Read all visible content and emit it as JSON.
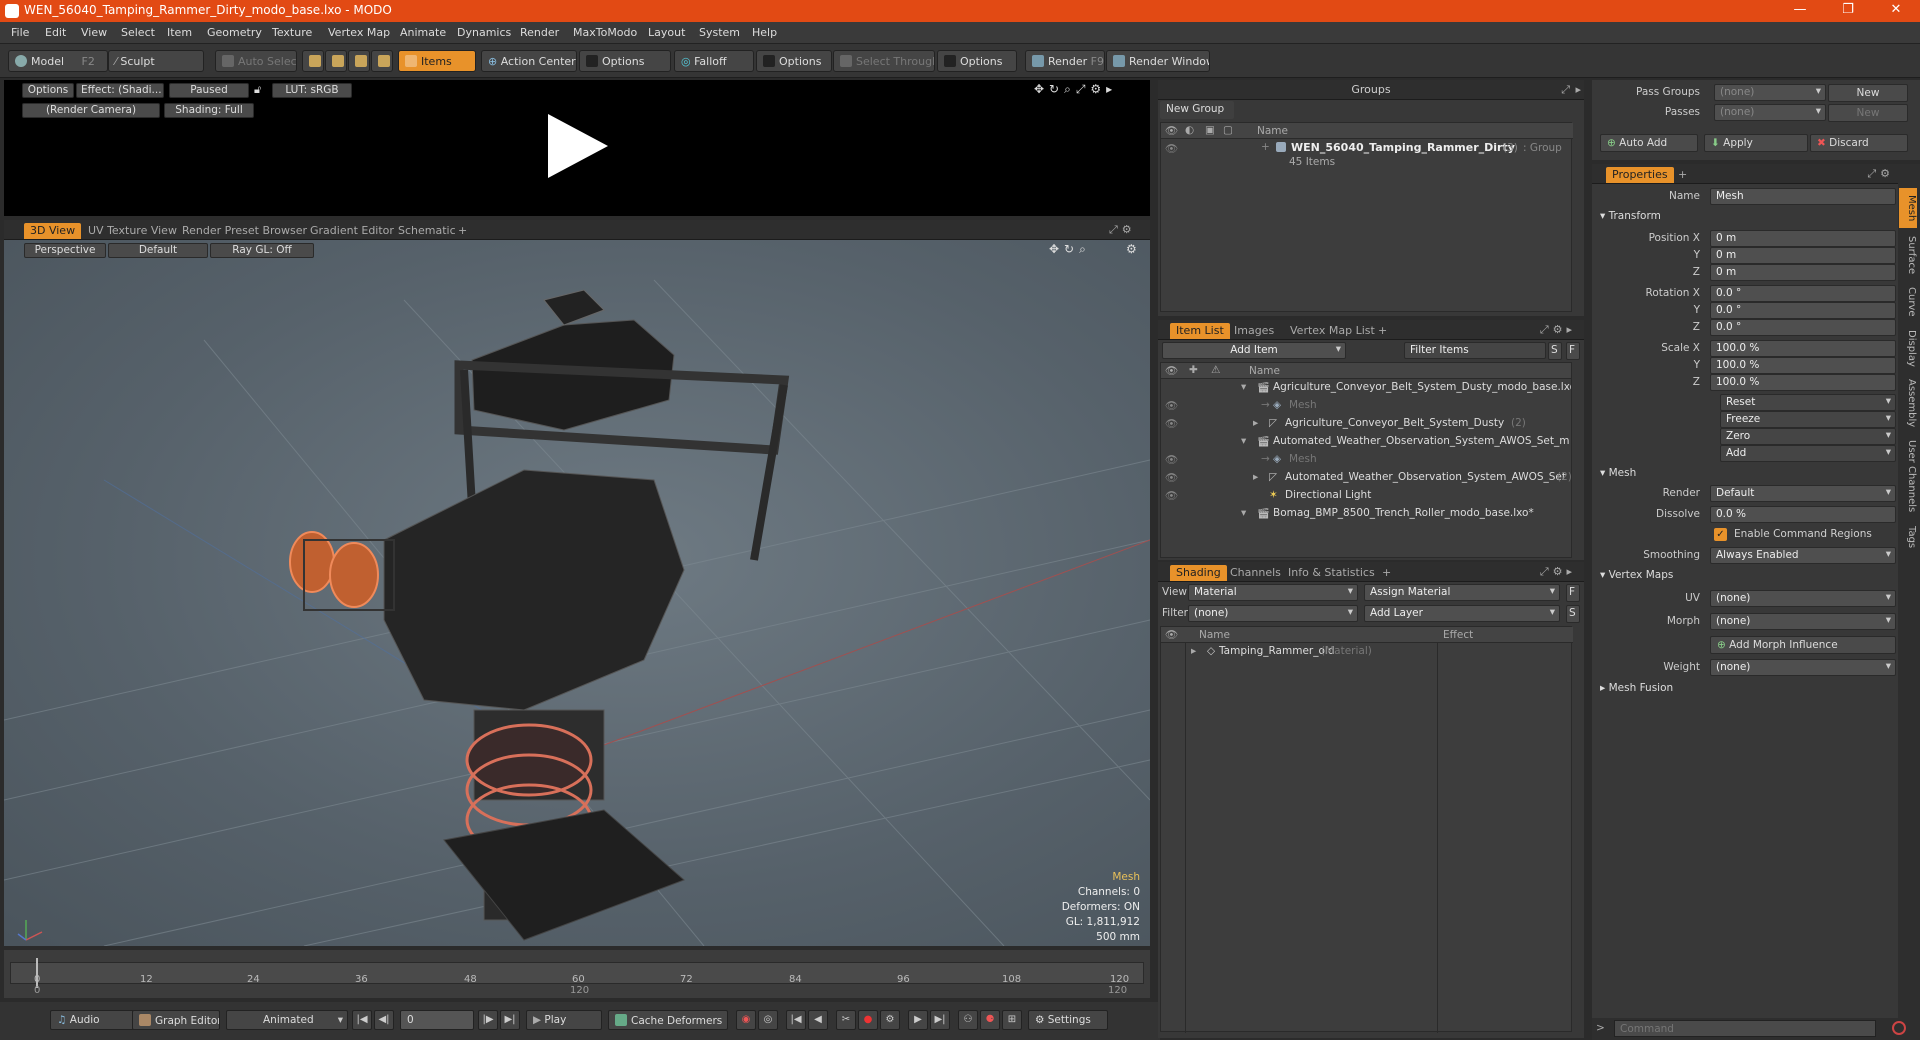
{
  "window": {
    "title": "WEN_56040_Tamping_Rammer_Dirty_modo_base.lxo - MODO",
    "minimize": "—",
    "maximize": "❐",
    "close": "✕"
  },
  "menu": [
    "File",
    "Edit",
    "View",
    "Select",
    "Item",
    "Geometry",
    "Texture",
    "Vertex Map",
    "Animate",
    "Dynamics",
    "Render",
    "MaxToModo",
    "Layout",
    "System",
    "Help"
  ],
  "toolbar": {
    "model": "Model",
    "model_key": "F2",
    "sculpt": "Sculpt",
    "auto_select": "Auto Select",
    "items": "Items",
    "action_center": "Action Center",
    "options1": "Options",
    "falloff": "Falloff",
    "options2": "Options",
    "select_through": "Select Through",
    "options3": "Options",
    "render": "Render",
    "render_key": "F9",
    "render_window": "Render Window"
  },
  "preview": {
    "options": "Options",
    "effect": "Effect: (Shadi...",
    "paused": "Paused",
    "lut": "LUT: sRGB",
    "camera": "(Render Camera)",
    "shading": "Shading: Full"
  },
  "viewport_tabs": [
    "3D View",
    "UV Texture View",
    "Render Preset Browser",
    "Gradient Editor",
    "Schematic",
    "+"
  ],
  "viewport": {
    "perspective": "Perspective",
    "default": "Default",
    "raygl": "Ray GL: Off",
    "info_title": "Mesh",
    "channels": "Channels: 0",
    "deformers": "Deformers: ON",
    "gl": "GL: 1,811,912",
    "scale": "500 mm"
  },
  "groups": {
    "title": "Groups",
    "new_group": "New Group",
    "col_name": "Name",
    "item_name": "WEN_56040_Tamping_Rammer_Dirty",
    "item_count": "(3)",
    "item_type": ": Group",
    "item_sub": "45 Items"
  },
  "passes": {
    "pass_groups": "Pass Groups",
    "passes": "Passes",
    "none1": "(none)",
    "none2": "(none)",
    "new1": "New",
    "new2": "New"
  },
  "actions": {
    "auto_add": "Auto Add",
    "apply": "Apply",
    "discard": "Discard"
  },
  "itemlist": {
    "tabs": [
      "Item List",
      "Images",
      "Vertex Map List",
      "+"
    ],
    "add_item": "Add Item",
    "filter": "Filter Items",
    "col_name": "Name",
    "rows": [
      {
        "text": "Agriculture_Conveyor_Belt_System_Dusty_modo_base.lxo*",
        "indent": 0,
        "dim": false
      },
      {
        "text": "Mesh",
        "indent": 2,
        "dim": true
      },
      {
        "text": "Agriculture_Conveyor_Belt_System_Dusty",
        "extra": "(2)",
        "indent": 1,
        "dim": false
      },
      {
        "text": "Automated_Weather_Observation_System_AWOS_Set_m ...",
        "indent": 0,
        "dim": false
      },
      {
        "text": "Mesh",
        "indent": 2,
        "dim": true
      },
      {
        "text": "Automated_Weather_Observation_System_AWOS_Set",
        "extra": "(2)",
        "indent": 1,
        "dim": false
      },
      {
        "text": "Directional Light",
        "indent": 1,
        "dim": false
      },
      {
        "text": "Bomag_BMP_8500_Trench_Roller_modo_base.lxo*",
        "indent": 0,
        "dim": false
      }
    ]
  },
  "shading": {
    "tabs": [
      "Shading",
      "Channels",
      "Info & Statistics",
      "+"
    ],
    "view_label": "View",
    "view_value": "Material",
    "assign": "Assign Material",
    "filter_label": "Filter",
    "filter_value": "(none)",
    "add_layer": "Add Layer",
    "col_name": "Name",
    "col_effect": "Effect",
    "row_name": "Tamping_Rammer_old",
    "row_type": "(Material)"
  },
  "properties": {
    "tab": "Properties",
    "name_label": "Name",
    "name_value": "Mesh",
    "transform": "Transform",
    "position_label": "Position X",
    "pos": [
      "0 m",
      "0 m",
      "0 m"
    ],
    "rotation_label": "Rotation X",
    "rot": [
      "0.0 °",
      "0.0 °",
      "0.0 °"
    ],
    "scale_label": "Scale X",
    "scl": [
      "100.0 %",
      "100.0 %",
      "100.0 %"
    ],
    "y": "Y",
    "z": "Z",
    "reset": "Reset",
    "freeze": "Freeze",
    "zero": "Zero",
    "add": "Add",
    "mesh": "Mesh",
    "render_label": "Render",
    "render_value": "Default",
    "dissolve_label": "Dissolve",
    "dissolve_value": "0.0 %",
    "enable_cmd": "Enable Command Regions",
    "smoothing_label": "Smoothing",
    "smoothing_value": "Always Enabled",
    "vertex_maps": "Vertex Maps",
    "uv_label": "UV",
    "uv_value": "(none)",
    "morph_label": "Morph",
    "morph_value": "(none)",
    "add_morph": "Add Morph Influence",
    "weight_label": "Weight",
    "weight_value": "(none)",
    "mesh_fusion": "Mesh Fusion"
  },
  "side_tabs": [
    "Mesh",
    "Surface",
    "Curve",
    "Display",
    "Assembly",
    "User Channels",
    "Tags"
  ],
  "timeline": {
    "ticks": [
      "0",
      "12",
      "24",
      "36",
      "48",
      "60",
      "72",
      "84",
      "96",
      "108",
      "120"
    ],
    "low_start": "0",
    "low_mid": "120",
    "low_end": "120"
  },
  "bottombar": {
    "audio": "Audio",
    "graph": "Graph Editor",
    "animated": "Animated",
    "frame": "0",
    "play": "Play",
    "cache": "Cache Deformers",
    "settings": "Settings"
  },
  "command": {
    "placeholder": "Command"
  }
}
